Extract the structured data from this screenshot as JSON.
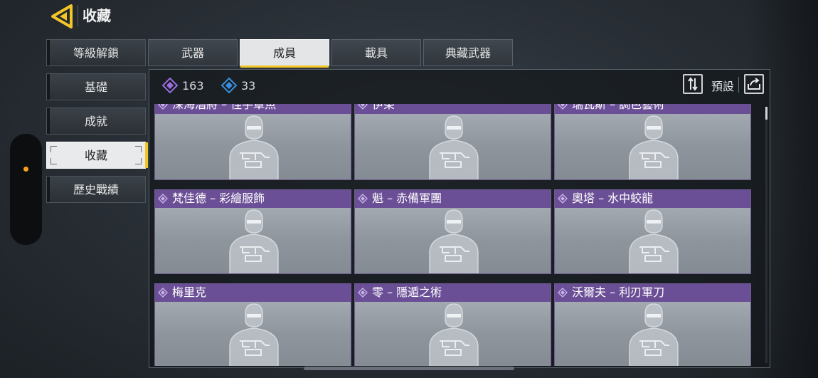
{
  "header": {
    "title": "收藏"
  },
  "sidebar": {
    "items": [
      {
        "label": "等級解鎖",
        "active": false
      },
      {
        "label": "基礎",
        "active": false
      },
      {
        "label": "成就",
        "active": false
      },
      {
        "label": "收藏",
        "active": true
      },
      {
        "label": "歷史戰績",
        "active": false
      }
    ]
  },
  "tabs": [
    {
      "label": "武器",
      "active": false
    },
    {
      "label": "成員",
      "active": true
    },
    {
      "label": "載具",
      "active": false
    },
    {
      "label": "典藏武器",
      "active": false
    }
  ],
  "currency": {
    "purple": {
      "value": "163",
      "icon": "purple-diamond-icon",
      "color": "#9b6fe0"
    },
    "blue": {
      "value": "33",
      "icon": "blue-diamond-icon",
      "color": "#3a8fdc"
    }
  },
  "toolbar": {
    "preset_label": "預設",
    "sort_icon": "sort-icon",
    "share_icon": "share-icon"
  },
  "cards": [
    {
      "name": "深海潛將 – 怪手章魚"
    },
    {
      "name": "伊榮"
    },
    {
      "name": "瑞瓦斯 – 調色藝術"
    },
    {
      "name": "梵佳德 – 彩繪服飾"
    },
    {
      "name": "魁 – 赤備軍團"
    },
    {
      "name": "奧塔 – 水中蛟龍"
    },
    {
      "name": "梅里克"
    },
    {
      "name": "零 – 隱遁之術"
    },
    {
      "name": "沃爾夫 – 利刃軍刀"
    }
  ],
  "colors": {
    "accent_yellow": "#f3c627",
    "card_header_purple": "#6b4f96",
    "edge_dot_orange": "#f4a21d"
  }
}
